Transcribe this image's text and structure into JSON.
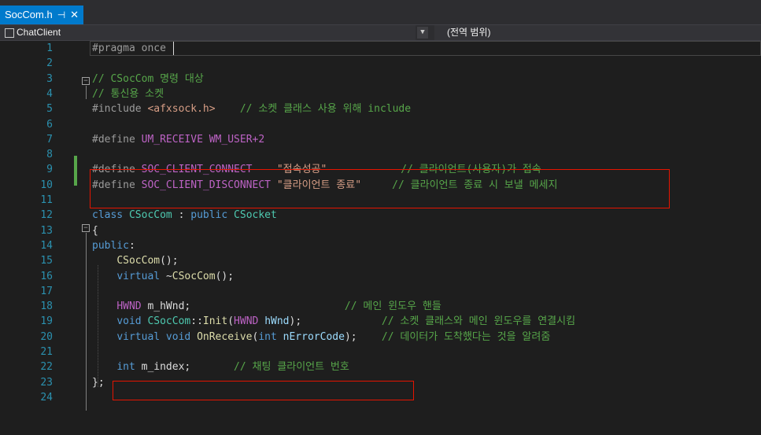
{
  "tab": {
    "title": "SocCom.h",
    "pin": "⊣",
    "close": "✕"
  },
  "nav": {
    "project": "ChatClient",
    "scope": "(전역 범위)"
  },
  "lines": [
    {
      "n": "1",
      "seg": [
        [
          "pp",
          "#pragma once"
        ]
      ]
    },
    {
      "n": "2",
      "seg": []
    },
    {
      "n": "3",
      "seg": [
        [
          "cm",
          "// CSocCom 명령 대상"
        ]
      ]
    },
    {
      "n": "4",
      "seg": [
        [
          "cm",
          "// 통신용 소켓"
        ]
      ]
    },
    {
      "n": "5",
      "seg": [
        [
          "pp",
          "#include "
        ],
        [
          "str",
          "<afxsock.h>"
        ],
        [
          "pl",
          "    "
        ],
        [
          "cm",
          "// 소켓 클래스 사용 위해 include"
        ]
      ]
    },
    {
      "n": "6",
      "seg": []
    },
    {
      "n": "7",
      "seg": [
        [
          "pp",
          "#define "
        ],
        [
          "mac",
          "UM_RECEIVE"
        ],
        [
          "pl",
          " "
        ],
        [
          "mac",
          "WM_USER+2"
        ]
      ]
    },
    {
      "n": "8",
      "seg": []
    },
    {
      "n": "9",
      "seg": [
        [
          "pp",
          "#define "
        ],
        [
          "mac",
          "SOC_CLIENT_CONNECT"
        ],
        [
          "pl",
          "    "
        ],
        [
          "str",
          "\"접속성공\""
        ],
        [
          "pl",
          "            "
        ],
        [
          "cm",
          "// 클라이언트(사용자)가 접속"
        ]
      ]
    },
    {
      "n": "10",
      "seg": [
        [
          "pp",
          "#define "
        ],
        [
          "mac",
          "SOC_CLIENT_DISCONNECT"
        ],
        [
          "pl",
          " "
        ],
        [
          "str",
          "\"클라이언트 종료\""
        ],
        [
          "pl",
          "     "
        ],
        [
          "cm",
          "// 클라이언트 종료 시 보낼 메세지"
        ]
      ]
    },
    {
      "n": "11",
      "seg": []
    },
    {
      "n": "12",
      "seg": [
        [
          "kw",
          "class "
        ],
        [
          "ty",
          "CSocCom"
        ],
        [
          "pl",
          " : "
        ],
        [
          "kw",
          "public "
        ],
        [
          "ty",
          "CSocket"
        ]
      ]
    },
    {
      "n": "13",
      "seg": [
        [
          "pl",
          "{"
        ]
      ]
    },
    {
      "n": "14",
      "seg": [
        [
          "kw",
          "public"
        ],
        [
          "pl",
          ":"
        ]
      ]
    },
    {
      "n": "15",
      "seg": [
        [
          "pl",
          "    "
        ],
        [
          "fn",
          "CSocCom"
        ],
        [
          "pl",
          "();"
        ]
      ]
    },
    {
      "n": "16",
      "seg": [
        [
          "pl",
          "    "
        ],
        [
          "kw",
          "virtual "
        ],
        [
          "pl",
          "~"
        ],
        [
          "fn",
          "CSocCom"
        ],
        [
          "pl",
          "();"
        ]
      ]
    },
    {
      "n": "17",
      "seg": []
    },
    {
      "n": "18",
      "seg": [
        [
          "pl",
          "    "
        ],
        [
          "mac",
          "HWND"
        ],
        [
          "pl",
          " m_hWnd;"
        ],
        [
          "pl",
          "                         "
        ],
        [
          "cm",
          "// 메인 윈도우 핸들"
        ]
      ]
    },
    {
      "n": "19",
      "seg": [
        [
          "pl",
          "    "
        ],
        [
          "kw",
          "void "
        ],
        [
          "ty",
          "CSocCom"
        ],
        [
          "pl",
          "::"
        ],
        [
          "fn",
          "Init"
        ],
        [
          "pl",
          "("
        ],
        [
          "mac",
          "HWND"
        ],
        [
          "pl",
          " "
        ],
        [
          "par",
          "hWnd"
        ],
        [
          "pl",
          ");"
        ],
        [
          "pl",
          "             "
        ],
        [
          "cm",
          "// 소켓 클래스와 메인 윈도우를 연결시킴"
        ]
      ]
    },
    {
      "n": "20",
      "seg": [
        [
          "pl",
          "    "
        ],
        [
          "kw",
          "virtual void "
        ],
        [
          "fn",
          "OnReceive"
        ],
        [
          "pl",
          "("
        ],
        [
          "kw",
          "int "
        ],
        [
          "par",
          "nErrorCode"
        ],
        [
          "pl",
          ");"
        ],
        [
          "pl",
          "    "
        ],
        [
          "cm",
          "// 데이터가 도착했다는 것을 알려줌"
        ]
      ]
    },
    {
      "n": "21",
      "seg": []
    },
    {
      "n": "22",
      "seg": [
        [
          "pl",
          "    "
        ],
        [
          "kw",
          "int "
        ],
        [
          "pl",
          "m_index;"
        ],
        [
          "pl",
          "       "
        ],
        [
          "cm",
          "// 채팅 클라이언트 번호"
        ]
      ]
    },
    {
      "n": "23",
      "seg": [
        [
          "pl",
          "};"
        ]
      ]
    },
    {
      "n": "24",
      "seg": []
    }
  ],
  "fold_markers": [
    "−",
    "−"
  ]
}
